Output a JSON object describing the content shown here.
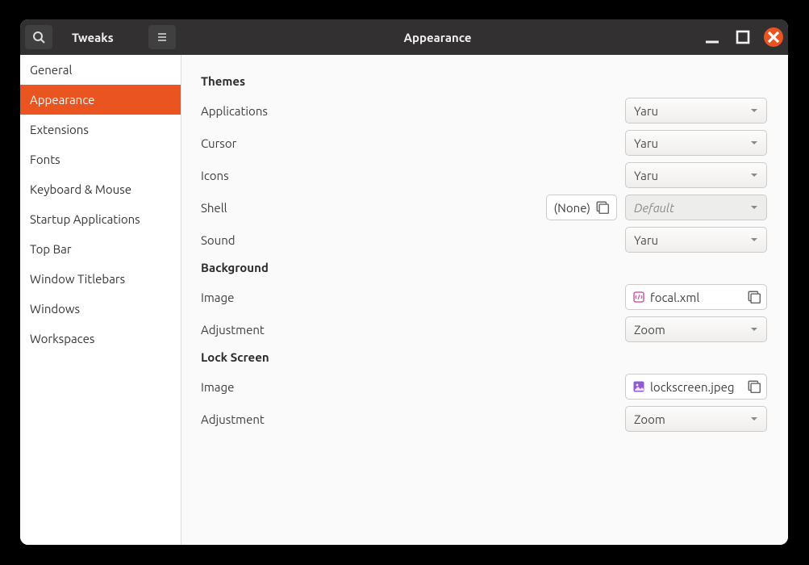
{
  "app_title": "Tweaks",
  "page_title": "Appearance",
  "sidebar": {
    "items": [
      {
        "label": "General"
      },
      {
        "label": "Appearance"
      },
      {
        "label": "Extensions"
      },
      {
        "label": "Fonts"
      },
      {
        "label": "Keyboard & Mouse"
      },
      {
        "label": "Startup Applications"
      },
      {
        "label": "Top Bar"
      },
      {
        "label": "Window Titlebars"
      },
      {
        "label": "Windows"
      },
      {
        "label": "Workspaces"
      }
    ],
    "selected_index": 1
  },
  "sections": {
    "themes": {
      "title": "Themes",
      "applications": {
        "label": "Applications",
        "value": "Yaru"
      },
      "cursor": {
        "label": "Cursor",
        "value": "Yaru"
      },
      "icons": {
        "label": "Icons",
        "value": "Yaru"
      },
      "shell": {
        "label": "Shell",
        "none_label": "(None)",
        "value": "Default"
      },
      "sound": {
        "label": "Sound",
        "value": "Yaru"
      }
    },
    "background": {
      "title": "Background",
      "image": {
        "label": "Image",
        "value": "focal.xml"
      },
      "adjustment": {
        "label": "Adjustment",
        "value": "Zoom"
      }
    },
    "lockscreen": {
      "title": "Lock Screen",
      "image": {
        "label": "Image",
        "value": "lockscreen.jpeg"
      },
      "adjustment": {
        "label": "Adjustment",
        "value": "Zoom"
      }
    }
  }
}
